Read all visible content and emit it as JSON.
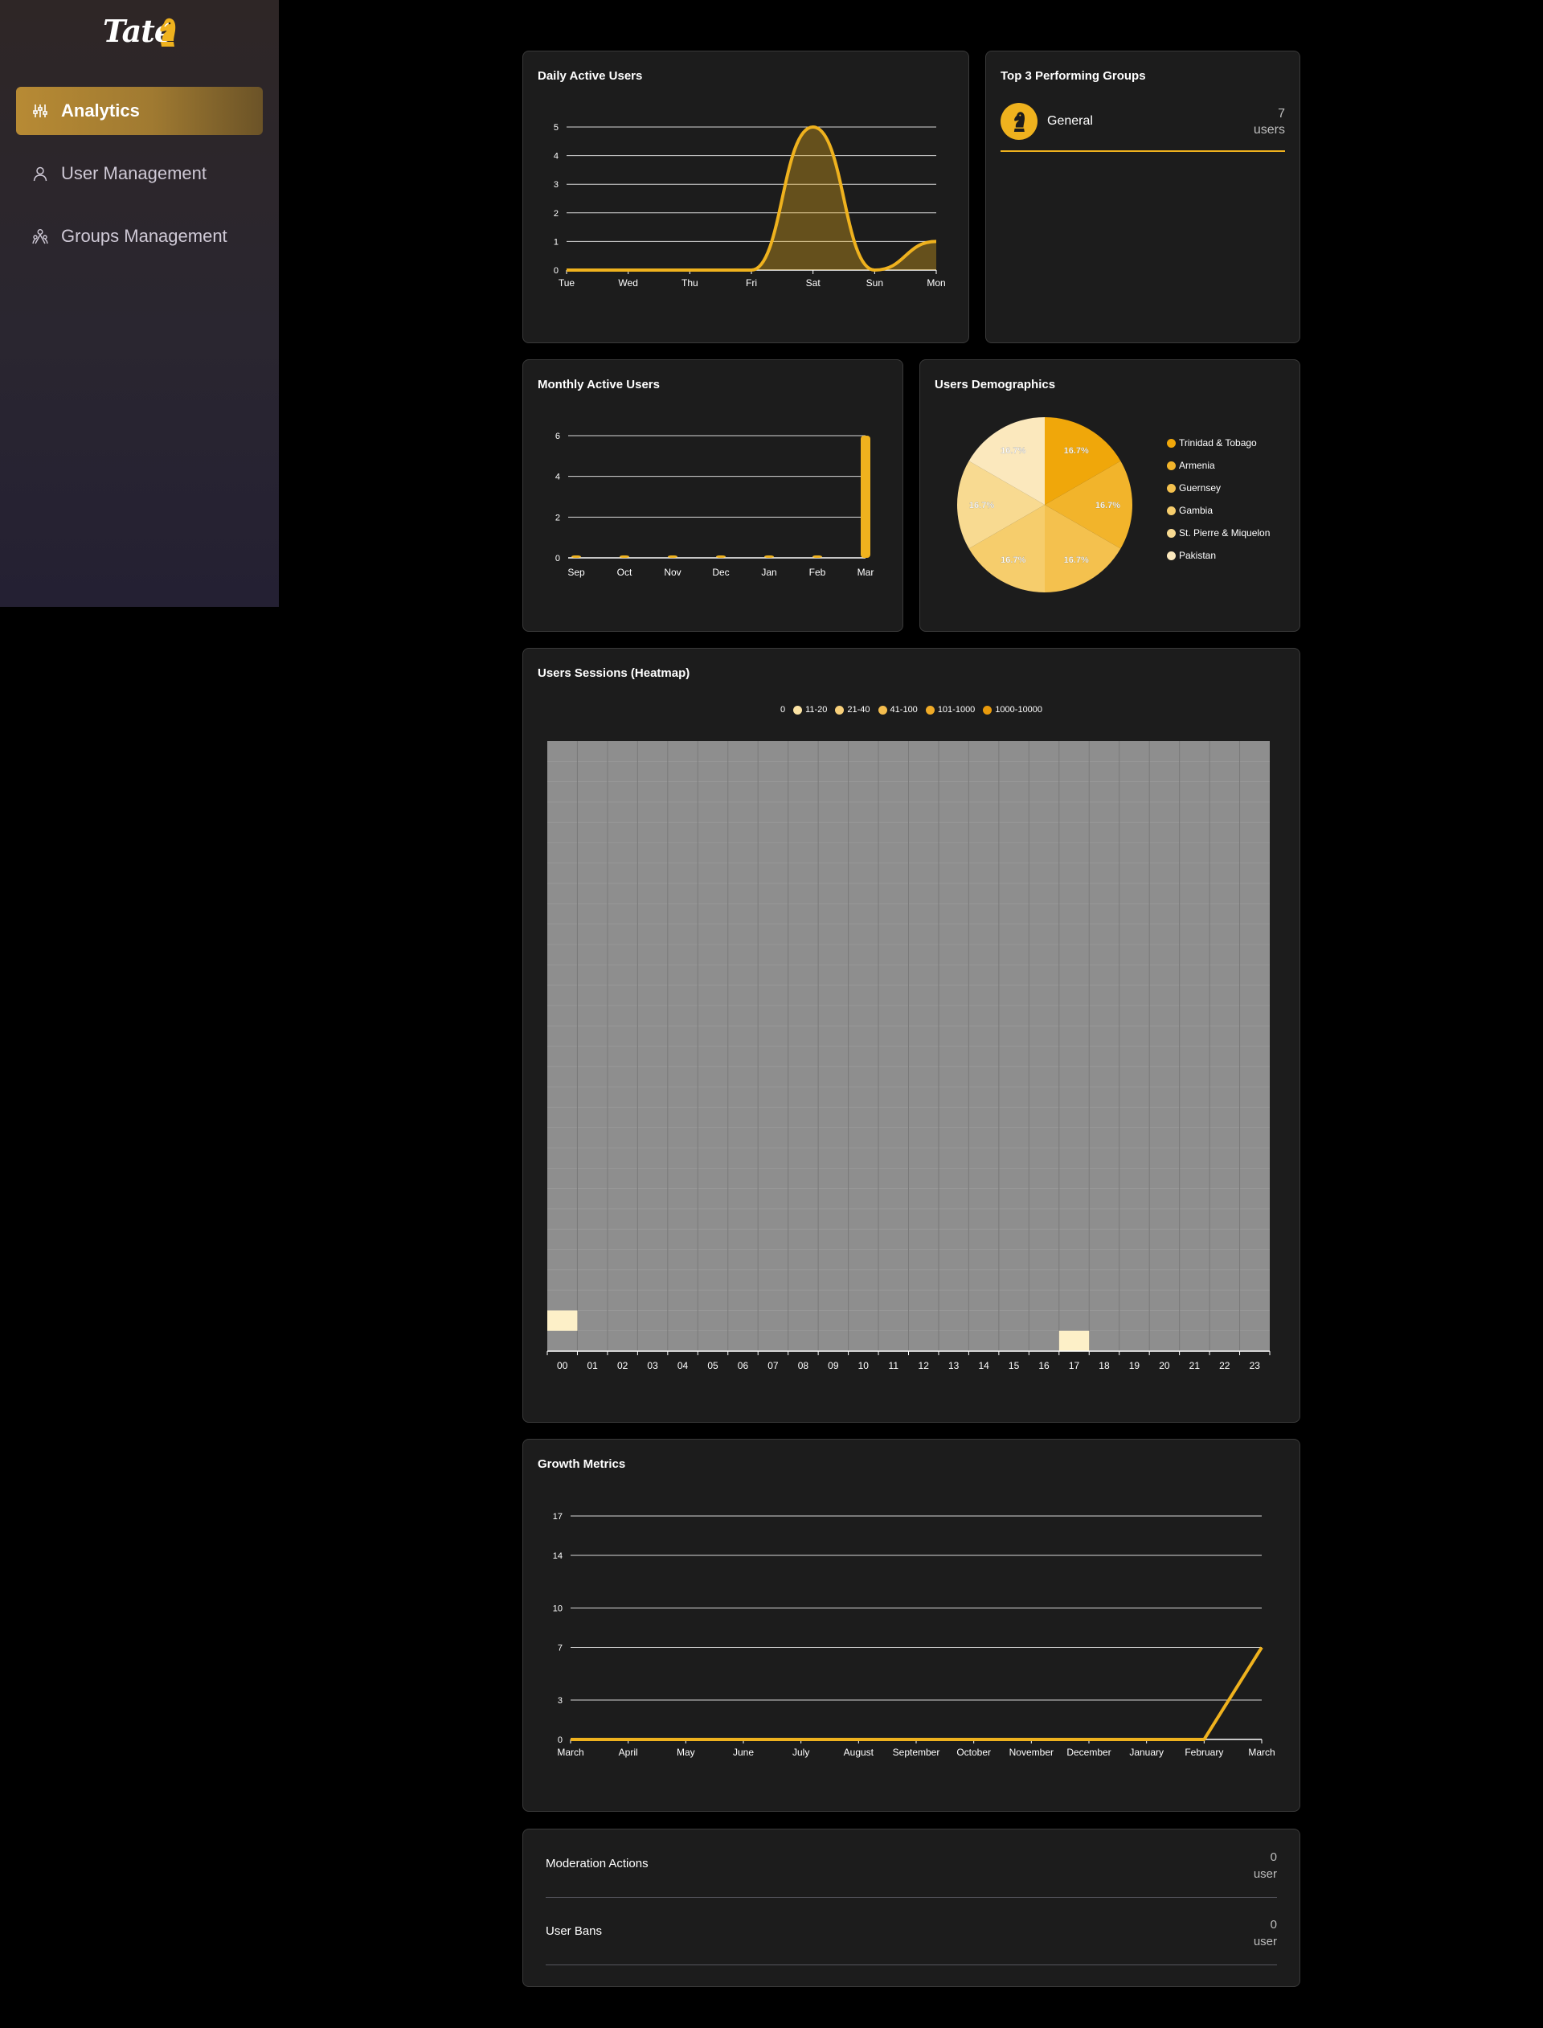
{
  "logo": {
    "text": "Tate"
  },
  "sidebar": {
    "items": [
      {
        "label": "Analytics",
        "icon": "sliders-icon",
        "active": true
      },
      {
        "label": "User Management",
        "icon": "user-icon",
        "active": false
      },
      {
        "label": "Groups Management",
        "icon": "group-icon",
        "active": false
      }
    ]
  },
  "colors": {
    "accent": "#efb21e",
    "card": "#1c1c1c",
    "page": "#000000"
  },
  "daily": {
    "title": "Daily Active Users",
    "chart_data": {
      "type": "area",
      "categories": [
        "Tue",
        "Wed",
        "Thu",
        "Fri",
        "Sat",
        "Sun",
        "Mon"
      ],
      "values": [
        0,
        0,
        0,
        0,
        5,
        0,
        1
      ],
      "yticks": [
        0,
        1,
        2,
        3,
        4,
        5
      ],
      "ylim": [
        0,
        5
      ]
    }
  },
  "top_groups": {
    "title": "Top 3 Performing Groups",
    "items": [
      {
        "name": "General",
        "count": "7",
        "unit": "users"
      }
    ]
  },
  "monthly": {
    "title": "Monthly Active Users",
    "chart_data": {
      "type": "bar",
      "categories": [
        "Sep",
        "Oct",
        "Nov",
        "Dec",
        "Jan",
        "Feb",
        "Mar"
      ],
      "values": [
        0,
        0,
        0,
        0,
        0,
        0,
        6
      ],
      "yticks": [
        0,
        2,
        4,
        6
      ],
      "ylim": [
        0,
        6
      ]
    }
  },
  "demographics": {
    "title": "Users Demographics",
    "chart_data": {
      "type": "pie",
      "labels": [
        "Trinidad & Tobago",
        "Armenia",
        "Guernsey",
        "Gambia",
        "St. Pierre & Miquelon",
        "Pakistan"
      ],
      "values": [
        16.7,
        16.7,
        16.7,
        16.7,
        16.7,
        16.7
      ],
      "value_labels": [
        "16.7%",
        "16.7%",
        "16.7%",
        "16.7%",
        "16.7%",
        "16.7%"
      ],
      "colors": [
        "#f0a70a",
        "#f2b42b",
        "#f4c14e",
        "#f6cd6c",
        "#f8da91",
        "#fbe8bd"
      ]
    }
  },
  "heatmap": {
    "title": "Users Sessions (Heatmap)",
    "legend": [
      {
        "label": "0",
        "color": ""
      },
      {
        "label": "11-20",
        "color": "#fbe3a4"
      },
      {
        "label": "21-40",
        "color": "#f8d07a"
      },
      {
        "label": "41-100",
        "color": "#f4bd4e"
      },
      {
        "label": "101-1000",
        "color": "#f0ab27"
      },
      {
        "label": "1000-10000",
        "color": "#e89a0c"
      }
    ],
    "chart_data": {
      "type": "heatmap",
      "x_categories": [
        "00",
        "01",
        "02",
        "03",
        "04",
        "05",
        "06",
        "07",
        "08",
        "09",
        "10",
        "11",
        "12",
        "13",
        "14",
        "15",
        "16",
        "17",
        "18",
        "19",
        "20",
        "21",
        "22",
        "23"
      ],
      "rows": 30,
      "highlighted_cells": [
        {
          "hour": "00",
          "row": 1
        },
        {
          "hour": "17",
          "row": 0
        }
      ],
      "highlight_color": "#fdf0c8",
      "base_color": "#8e8e8e"
    }
  },
  "growth": {
    "title": "Growth Metrics",
    "chart_data": {
      "type": "line",
      "categories": [
        "March",
        "April",
        "May",
        "June",
        "July",
        "August",
        "September",
        "October",
        "November",
        "December",
        "January",
        "February",
        "March"
      ],
      "values": [
        0,
        0,
        0,
        0,
        0,
        0,
        0,
        0,
        0,
        0,
        0,
        0,
        7
      ],
      "yticks": [
        0,
        3,
        7,
        10,
        14,
        17
      ],
      "ylim": [
        0,
        17
      ]
    }
  },
  "moderation": {
    "rows": [
      {
        "label": "Moderation Actions",
        "value": "0",
        "unit": "user"
      },
      {
        "label": "User Bans",
        "value": "0",
        "unit": "user"
      }
    ]
  }
}
